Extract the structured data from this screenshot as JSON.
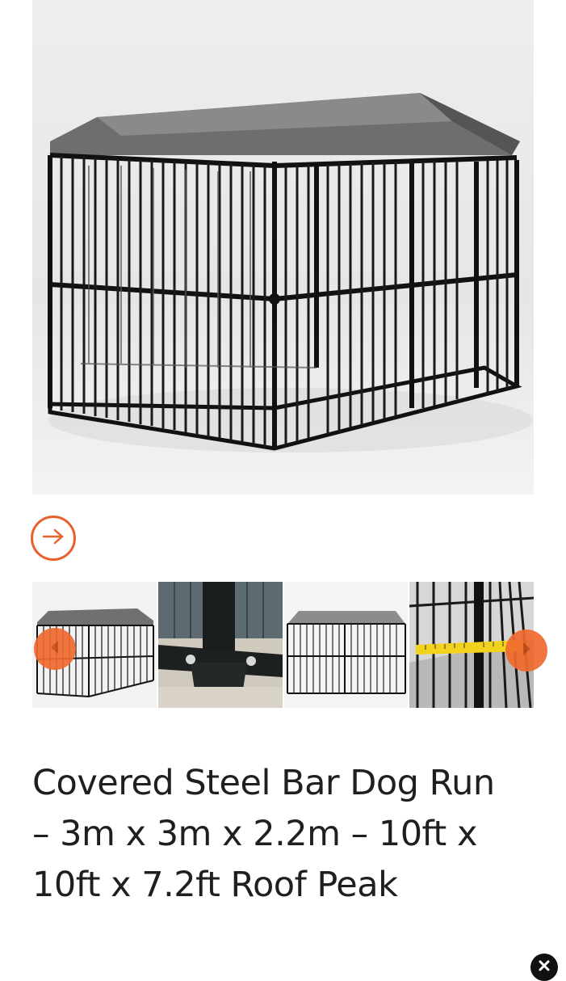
{
  "product": {
    "title": "Covered Steel Bar Dog Run – 3m x 3m x 2.2m – 10ft x 10ft x 7.2ft Roof Peak"
  },
  "gallery": {
    "next_icon": "arrow-right-circle-icon",
    "thumbnails": [
      {
        "subject": "covered dog run"
      },
      {
        "subject": "steel post base bracket"
      },
      {
        "subject": "covered dog run front"
      },
      {
        "subject": "tape measure on bars"
      }
    ],
    "prev_icon": "chevron-left-icon",
    "next_thumb_icon": "chevron-right-icon"
  },
  "overlay": {
    "close_icon": "close-icon"
  },
  "colors": {
    "accent": "#e8612c",
    "title_text": "#1f1f1f"
  }
}
